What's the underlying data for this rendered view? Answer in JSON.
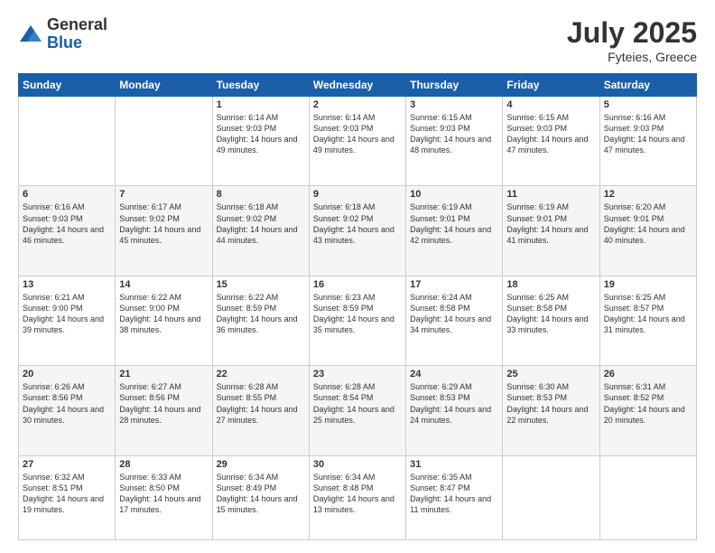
{
  "header": {
    "logo_general": "General",
    "logo_blue": "Blue",
    "month_year": "July 2025",
    "location": "Fyteies, Greece"
  },
  "days_of_week": [
    "Sunday",
    "Monday",
    "Tuesday",
    "Wednesday",
    "Thursday",
    "Friday",
    "Saturday"
  ],
  "weeks": [
    {
      "row_alt": false,
      "days": [
        {
          "num": "",
          "info": ""
        },
        {
          "num": "",
          "info": ""
        },
        {
          "num": "1",
          "info": "Sunrise: 6:14 AM\nSunset: 9:03 PM\nDaylight: 14 hours and 49 minutes."
        },
        {
          "num": "2",
          "info": "Sunrise: 6:14 AM\nSunset: 9:03 PM\nDaylight: 14 hours and 49 minutes."
        },
        {
          "num": "3",
          "info": "Sunrise: 6:15 AM\nSunset: 9:03 PM\nDaylight: 14 hours and 48 minutes."
        },
        {
          "num": "4",
          "info": "Sunrise: 6:15 AM\nSunset: 9:03 PM\nDaylight: 14 hours and 47 minutes."
        },
        {
          "num": "5",
          "info": "Sunrise: 6:16 AM\nSunset: 9:03 PM\nDaylight: 14 hours and 47 minutes."
        }
      ]
    },
    {
      "row_alt": true,
      "days": [
        {
          "num": "6",
          "info": "Sunrise: 6:16 AM\nSunset: 9:03 PM\nDaylight: 14 hours and 46 minutes."
        },
        {
          "num": "7",
          "info": "Sunrise: 6:17 AM\nSunset: 9:02 PM\nDaylight: 14 hours and 45 minutes."
        },
        {
          "num": "8",
          "info": "Sunrise: 6:18 AM\nSunset: 9:02 PM\nDaylight: 14 hours and 44 minutes."
        },
        {
          "num": "9",
          "info": "Sunrise: 6:18 AM\nSunset: 9:02 PM\nDaylight: 14 hours and 43 minutes."
        },
        {
          "num": "10",
          "info": "Sunrise: 6:19 AM\nSunset: 9:01 PM\nDaylight: 14 hours and 42 minutes."
        },
        {
          "num": "11",
          "info": "Sunrise: 6:19 AM\nSunset: 9:01 PM\nDaylight: 14 hours and 41 minutes."
        },
        {
          "num": "12",
          "info": "Sunrise: 6:20 AM\nSunset: 9:01 PM\nDaylight: 14 hours and 40 minutes."
        }
      ]
    },
    {
      "row_alt": false,
      "days": [
        {
          "num": "13",
          "info": "Sunrise: 6:21 AM\nSunset: 9:00 PM\nDaylight: 14 hours and 39 minutes."
        },
        {
          "num": "14",
          "info": "Sunrise: 6:22 AM\nSunset: 9:00 PM\nDaylight: 14 hours and 38 minutes."
        },
        {
          "num": "15",
          "info": "Sunrise: 6:22 AM\nSunset: 8:59 PM\nDaylight: 14 hours and 36 minutes."
        },
        {
          "num": "16",
          "info": "Sunrise: 6:23 AM\nSunset: 8:59 PM\nDaylight: 14 hours and 35 minutes."
        },
        {
          "num": "17",
          "info": "Sunrise: 6:24 AM\nSunset: 8:58 PM\nDaylight: 14 hours and 34 minutes."
        },
        {
          "num": "18",
          "info": "Sunrise: 6:25 AM\nSunset: 8:58 PM\nDaylight: 14 hours and 33 minutes."
        },
        {
          "num": "19",
          "info": "Sunrise: 6:25 AM\nSunset: 8:57 PM\nDaylight: 14 hours and 31 minutes."
        }
      ]
    },
    {
      "row_alt": true,
      "days": [
        {
          "num": "20",
          "info": "Sunrise: 6:26 AM\nSunset: 8:56 PM\nDaylight: 14 hours and 30 minutes."
        },
        {
          "num": "21",
          "info": "Sunrise: 6:27 AM\nSunset: 8:56 PM\nDaylight: 14 hours and 28 minutes."
        },
        {
          "num": "22",
          "info": "Sunrise: 6:28 AM\nSunset: 8:55 PM\nDaylight: 14 hours and 27 minutes."
        },
        {
          "num": "23",
          "info": "Sunrise: 6:28 AM\nSunset: 8:54 PM\nDaylight: 14 hours and 25 minutes."
        },
        {
          "num": "24",
          "info": "Sunrise: 6:29 AM\nSunset: 8:53 PM\nDaylight: 14 hours and 24 minutes."
        },
        {
          "num": "25",
          "info": "Sunrise: 6:30 AM\nSunset: 8:53 PM\nDaylight: 14 hours and 22 minutes."
        },
        {
          "num": "26",
          "info": "Sunrise: 6:31 AM\nSunset: 8:52 PM\nDaylight: 14 hours and 20 minutes."
        }
      ]
    },
    {
      "row_alt": false,
      "days": [
        {
          "num": "27",
          "info": "Sunrise: 6:32 AM\nSunset: 8:51 PM\nDaylight: 14 hours and 19 minutes."
        },
        {
          "num": "28",
          "info": "Sunrise: 6:33 AM\nSunset: 8:50 PM\nDaylight: 14 hours and 17 minutes."
        },
        {
          "num": "29",
          "info": "Sunrise: 6:34 AM\nSunset: 8:49 PM\nDaylight: 14 hours and 15 minutes."
        },
        {
          "num": "30",
          "info": "Sunrise: 6:34 AM\nSunset: 8:48 PM\nDaylight: 14 hours and 13 minutes."
        },
        {
          "num": "31",
          "info": "Sunrise: 6:35 AM\nSunset: 8:47 PM\nDaylight: 14 hours and 11 minutes."
        },
        {
          "num": "",
          "info": ""
        },
        {
          "num": "",
          "info": ""
        }
      ]
    }
  ]
}
